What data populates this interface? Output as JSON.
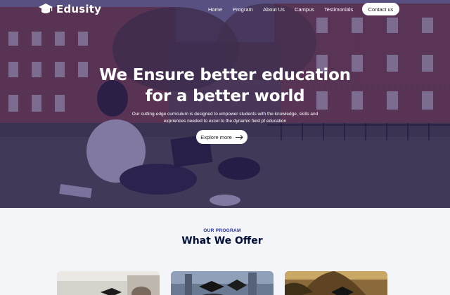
{
  "brand": {
    "name": "Edusity",
    "icon": "graduation-cap-icon"
  },
  "nav": {
    "links": [
      "Home",
      "Program",
      "About Us",
      "Campus",
      "Testimonials"
    ],
    "contact_label": "Contact us"
  },
  "hero": {
    "title_line1": "We Ensure better education",
    "title_line2": "for a better world",
    "subtitle_line1": "Our cutting-edge curriculum is designed to empower students with the knowledge, skills and",
    "subtitle_line2": "expriences needed to excel to the dynamic field pf education",
    "cta_label": "Explore more",
    "cta_icon": "arrow-right-icon"
  },
  "program": {
    "eyebrow": "OUR PROGRAM",
    "title": "What We Offer",
    "cards": [
      {
        "image": "graduates-photo"
      },
      {
        "image": "graduation-caps-photo"
      },
      {
        "image": "graduate-outdoors-photo"
      }
    ]
  },
  "colors": {
    "overlay": "#2e2066",
    "accent": "#212ea0",
    "heading": "#000f38",
    "page_bg": "#f4f5f9"
  }
}
